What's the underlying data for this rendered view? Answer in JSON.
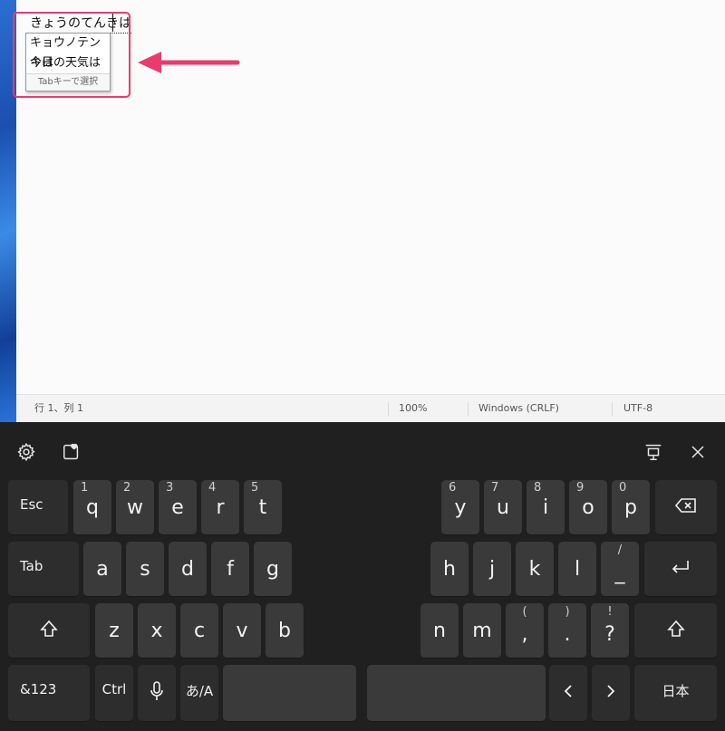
{
  "editor": {
    "composition": "きょうのてんきは",
    "candidates": [
      "キョウノテンキは",
      "今日の天気は"
    ],
    "candidate_hint": "Tabキーで選択"
  },
  "statusbar": {
    "position": "行 1、列 1",
    "zoom": "100%",
    "line_ending": "Windows (CRLF)",
    "encoding": "UTF-8"
  },
  "annotation": {
    "color": "#ea3a6e"
  },
  "keyboard": {
    "icons": [
      "settings-icon",
      "emoji-heart-icon",
      "dock-icon",
      "close-icon"
    ],
    "row1": {
      "esc": "Esc",
      "left": [
        {
          "num": "1",
          "key": "q"
        },
        {
          "num": "2",
          "key": "w"
        },
        {
          "num": "3",
          "key": "e"
        },
        {
          "num": "4",
          "key": "r"
        },
        {
          "num": "5",
          "key": "t"
        }
      ],
      "right": [
        {
          "num": "6",
          "key": "y"
        },
        {
          "num": "7",
          "key": "u"
        },
        {
          "num": "8",
          "key": "i"
        },
        {
          "num": "9",
          "key": "o"
        },
        {
          "num": "0",
          "key": "p"
        }
      ]
    },
    "row2": {
      "tab": "Tab",
      "left": [
        "a",
        "s",
        "d",
        "f",
        "g"
      ],
      "right": [
        {
          "key": "h"
        },
        {
          "key": "j"
        },
        {
          "key": "k"
        },
        {
          "key": "l"
        },
        {
          "sub": "/",
          "key": "_"
        }
      ]
    },
    "row3": {
      "left": [
        "z",
        "x",
        "c",
        "v",
        "b"
      ],
      "right": [
        {
          "key": "n"
        },
        {
          "key": "m"
        },
        {
          "sub": "(",
          "key": ","
        },
        {
          "sub": ")",
          "key": "."
        },
        {
          "sub": "!",
          "key": "?"
        }
      ]
    },
    "row4": {
      "sym": "&123",
      "ctrl": "Ctrl",
      "ime": "あ/A",
      "lang": "日本"
    }
  }
}
